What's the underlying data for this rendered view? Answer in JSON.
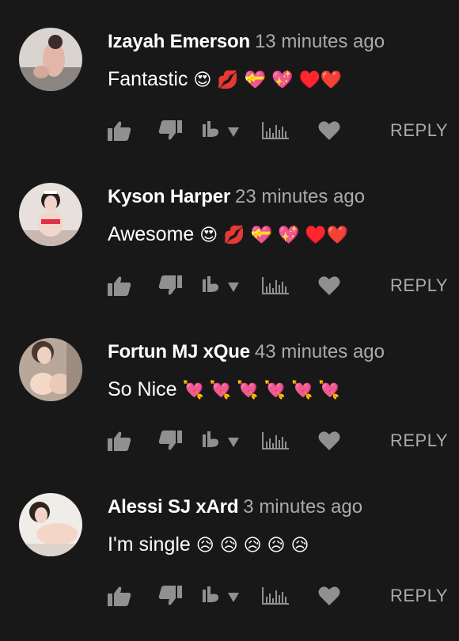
{
  "comments": [
    {
      "author": "Izayah Emerson",
      "time": "13 minutes ago",
      "text": "Fantastic",
      "emojis": "😍 💋 💝 💖 ♥️❤️",
      "reply_label": "REPLY",
      "avatar_tone": "#c9a9a0"
    },
    {
      "author": "Kyson Harper",
      "time": "23 minutes ago",
      "text": "Awesome",
      "emojis": "😍 💋 💝 💖 ♥️❤️",
      "reply_label": "REPLY",
      "avatar_tone": "#d8c0b8"
    },
    {
      "author": "Fortun MJ xQue",
      "time": "43 minutes ago",
      "text": "So Nice",
      "emojis": "💘 💘 💘 💘 💘 💘",
      "reply_label": "REPLY",
      "avatar_tone": "#c4a088"
    },
    {
      "author": "Alessi SJ xArd",
      "time": "3 minutes ago",
      "text": "I'm single",
      "emojis": "😥 😥 😥 😥 😥",
      "reply_label": "REPLY",
      "avatar_tone": "#e0c8c0"
    }
  ],
  "icons": {
    "like": "thumbs-up-icon",
    "dislike": "thumbs-down-icon",
    "vote": "vote-icon",
    "chart": "chart-icon",
    "heart": "heart-icon"
  },
  "colors": {
    "background": "#181818",
    "icon": "#909090",
    "secondary_text": "#aaaaaa"
  }
}
